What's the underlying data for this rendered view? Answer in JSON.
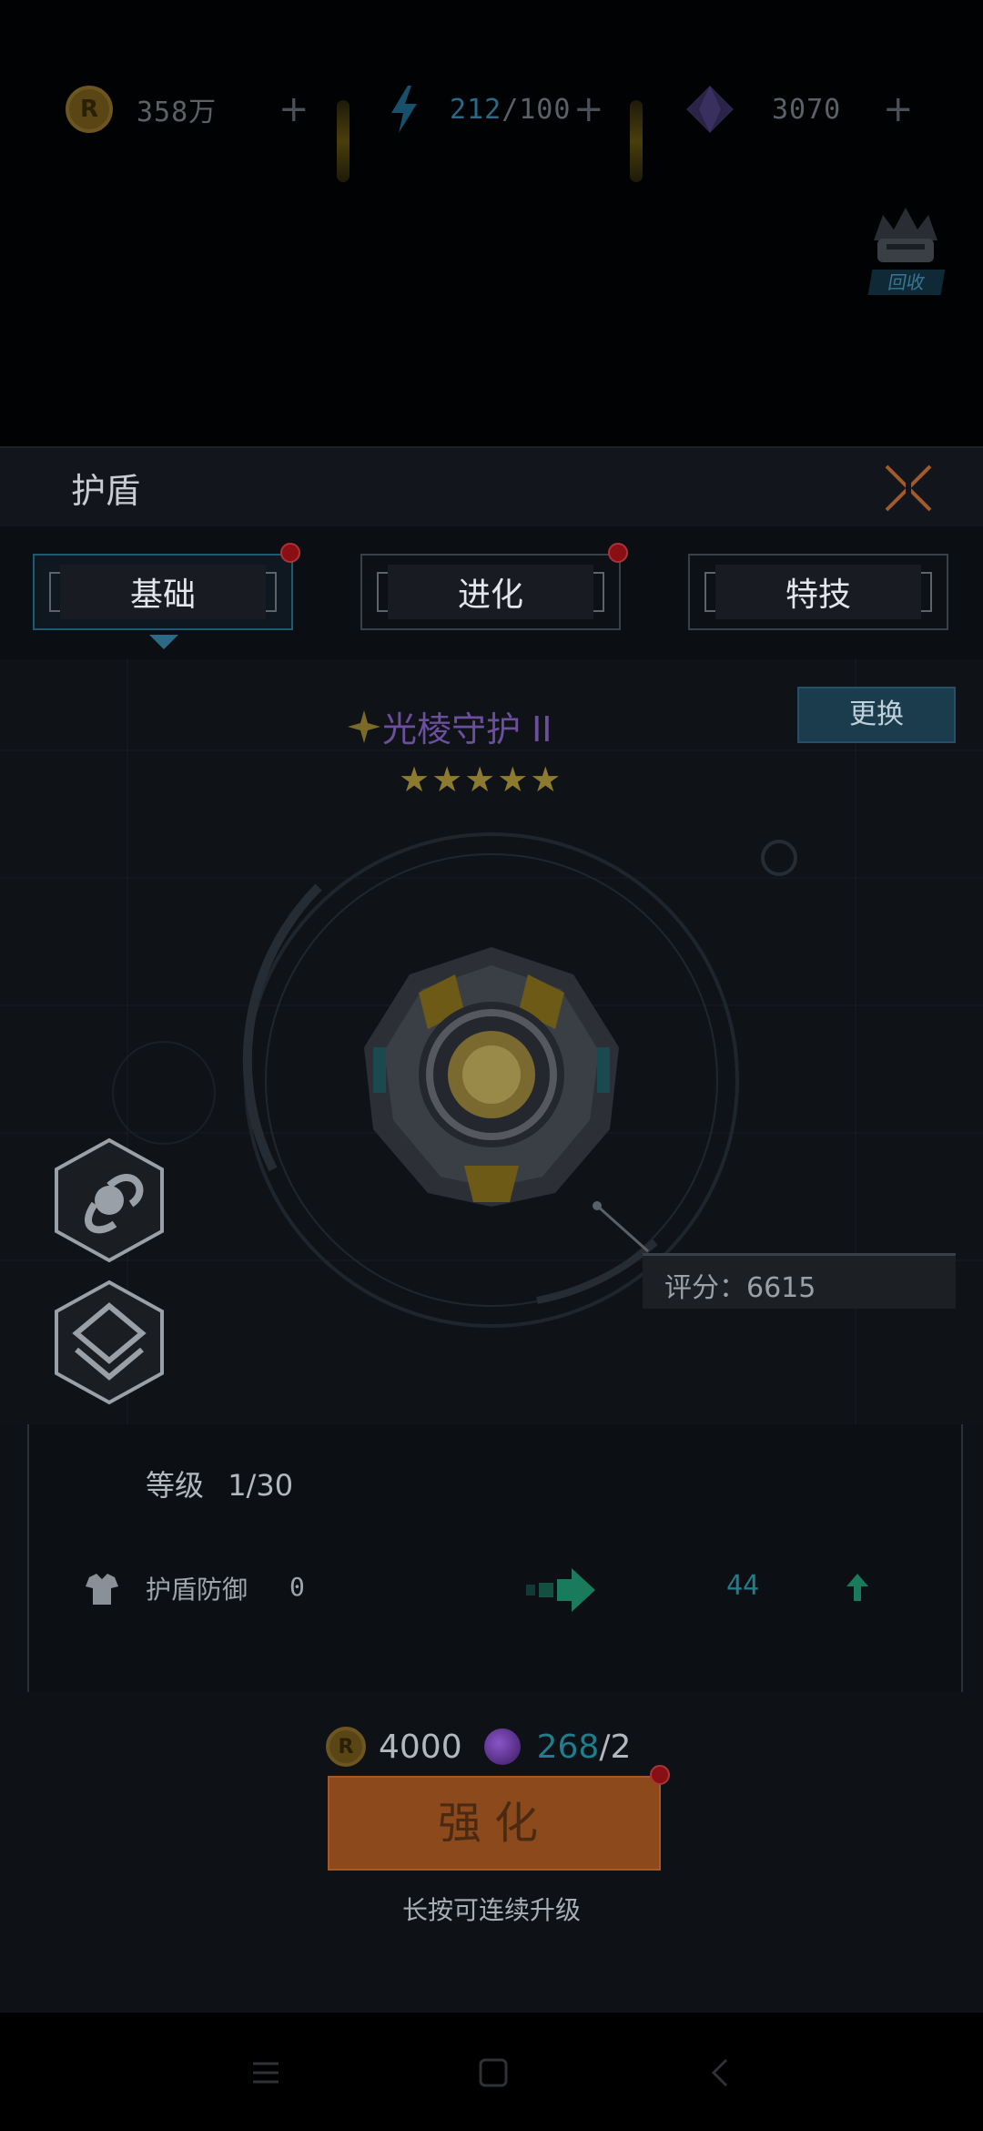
{
  "resources": {
    "coins": "358万",
    "energy_current": "212",
    "energy_sep": "/100",
    "gems": "3070",
    "plus": "+"
  },
  "recycle": {
    "label": "回收"
  },
  "panel": {
    "title": "护盾"
  },
  "tabs": [
    {
      "label": "基础",
      "active": true,
      "badge": true
    },
    {
      "label": "进化",
      "active": false,
      "badge": true
    },
    {
      "label": "特技",
      "active": false,
      "badge": false
    }
  ],
  "equipment": {
    "name": "光棱守护 II",
    "stars": "★★★★★",
    "replace_label": "更换",
    "score_label": "评分：6615"
  },
  "upgrade_info": {
    "level_label": "等级",
    "level_value": "1/30",
    "stat_label": "护盾防御",
    "stat_from": "0",
    "stat_to": "44"
  },
  "cost": {
    "coins": "4000",
    "orb_have": "268",
    "orb_need": "/2"
  },
  "upgrade_button": "强化",
  "hint": "长按可连续升级",
  "colors": {
    "accent": "#2b6a86",
    "upgrade": "#8c4a1c",
    "badge": "#8a0f14",
    "name": "#6b4e9c"
  }
}
